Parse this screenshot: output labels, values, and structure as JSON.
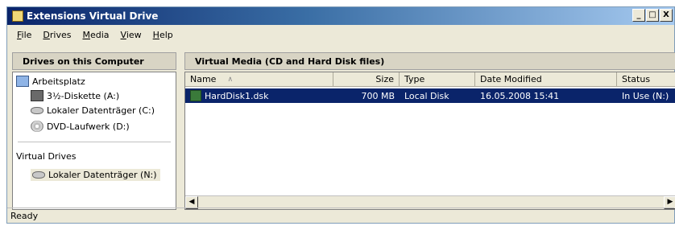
{
  "window": {
    "title": "Extensions Virtual Drive",
    "buttons": {
      "minimize": "_",
      "maximize": "□",
      "close": "X"
    }
  },
  "menu": [
    "File",
    "Drives",
    "Media",
    "View",
    "Help"
  ],
  "left_panel": {
    "header": "Drives on this Computer",
    "root": {
      "label": "Arbeitsplatz",
      "icon": "computer-icon"
    },
    "drives": [
      {
        "label": "3½-Diskette (A:)",
        "icon": "floppy-icon"
      },
      {
        "label": "Lokaler Datenträger (C:)",
        "icon": "hard-drive-icon"
      },
      {
        "label": "DVD-Laufwerk (D:)",
        "icon": "dvd-icon"
      }
    ],
    "virtual_section": "Virtual Drives",
    "virtual_drives": [
      {
        "label": "Lokaler Datenträger (N:)",
        "icon": "hard-drive-icon"
      }
    ]
  },
  "right_panel": {
    "header": "Virtual Media (CD and Hard Disk files)",
    "columns": [
      "Name",
      "Size",
      "Type",
      "Date Modified",
      "Status"
    ],
    "rows": [
      {
        "name": "HardDisk1.dsk",
        "size": "700 MB",
        "type": "Local Disk",
        "modified": "16.05.2008 15:41",
        "status": "In Use (N:)",
        "icon": "disk-image-icon"
      }
    ]
  },
  "status_bar": {
    "text": "Ready"
  },
  "colors": {
    "selection": "#0a246a",
    "title_start": "#0a246a",
    "title_end": "#a6caf0"
  }
}
